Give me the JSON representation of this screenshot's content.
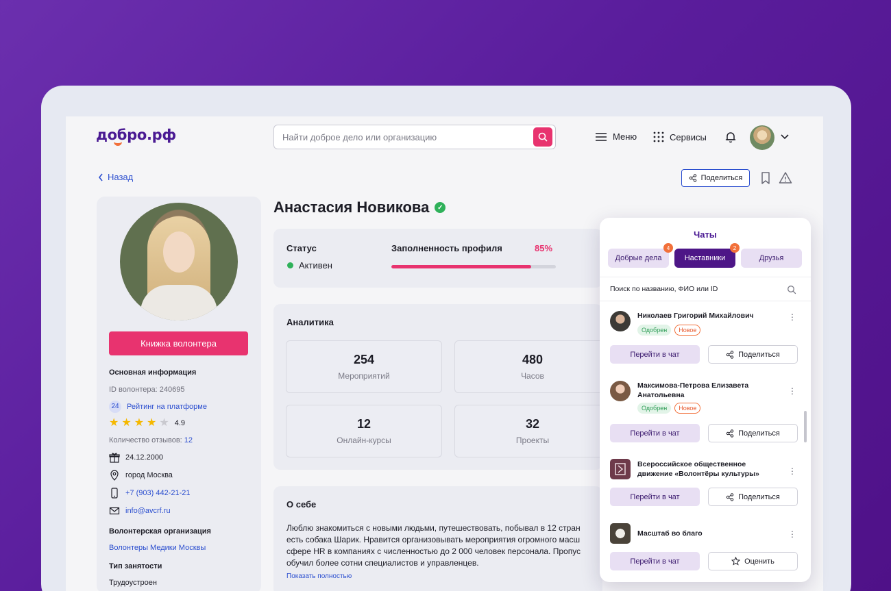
{
  "header": {
    "logo": "добро.рф",
    "search_placeholder": "Найти доброе дело или организацию",
    "menu_label": "Меню",
    "services_label": "Сервисы"
  },
  "toolbar": {
    "back_label": "Назад",
    "share_label": "Поделиться"
  },
  "profile": {
    "book_button": "Книжка волонтера",
    "main_info_title": "Основная информация",
    "volunteer_id": "ID волонтера: 240695",
    "rating_badge": "24",
    "rating_label": "Рейтинг на платформе",
    "stars": 4,
    "rating_value": "4.9",
    "reviews_label": "Количество отзывов:",
    "reviews_count": "12",
    "birthdate": "24.12.2000",
    "city": "город Москва",
    "phone": "+7 (903) 442-21-21",
    "email": "info@avcrf.ru",
    "org_title": "Волонтерская организация",
    "org_name": "Волонтеры Медики Москвы",
    "employment_title": "Тип занятости",
    "employment_value": "Трудоустроен"
  },
  "main": {
    "name": "Анастасия Новикова",
    "status_title": "Статус",
    "status_value": "Активен",
    "fill_title": "Заполненность профиля",
    "fill_percent": "85%",
    "fill_fraction": 0.85,
    "analytics_title": "Аналитика",
    "stats": [
      {
        "num": "254",
        "label": "Мероприятий"
      },
      {
        "num": "480",
        "label": "Часов"
      },
      {
        "num": "12",
        "label": "Онлайн-курсы"
      },
      {
        "num": "32",
        "label": "Проекты"
      }
    ],
    "about_title": "О себе",
    "about_lines": [
      "Люблю знакомиться  с новыми людьми, путешествовать, побывал в 12 стран",
      "есть собака Шарик. Нравится организовывать мероприятия огромного масш",
      "сфере HR в компаниях с численностью до 2 000 человек персонала. Пропус",
      "обучил более сотни специалистов и управленцев."
    ],
    "show_more": "Показать полностью"
  },
  "chats": {
    "title": "Чаты",
    "tabs": [
      {
        "label": "Добрые дела",
        "badge": "4"
      },
      {
        "label": "Наставники",
        "badge": "2"
      },
      {
        "label": "Друзья",
        "badge": ""
      }
    ],
    "search_placeholder": "Поиск по названию, ФИО или ID",
    "items": [
      {
        "name": "Николаев Григорий Михайлович",
        "tag_ok": "Одобрен",
        "tag_new": "Новое",
        "go": "Перейти в чат",
        "action": "Поделиться"
      },
      {
        "name": "Максимова-Петрова Елизавета Анатольевна",
        "tag_ok": "Одобрен",
        "tag_new": "Новое",
        "go": "Перейти в чат",
        "action": "Поделиться"
      },
      {
        "name": "Всероссийское общественное движение «Волонтёры культуры»",
        "go": "Перейти в чат",
        "action": "Поделиться"
      },
      {
        "name": "Масштаб во благо",
        "go": "Перейти в чат",
        "action": "Оценить"
      }
    ]
  },
  "colors": {
    "accent_pink": "#e8336f",
    "brand_purple": "#4d1687",
    "link_blue": "#2b4ecf",
    "success_green": "#2fb15a",
    "badge_orange": "#f2703a"
  }
}
